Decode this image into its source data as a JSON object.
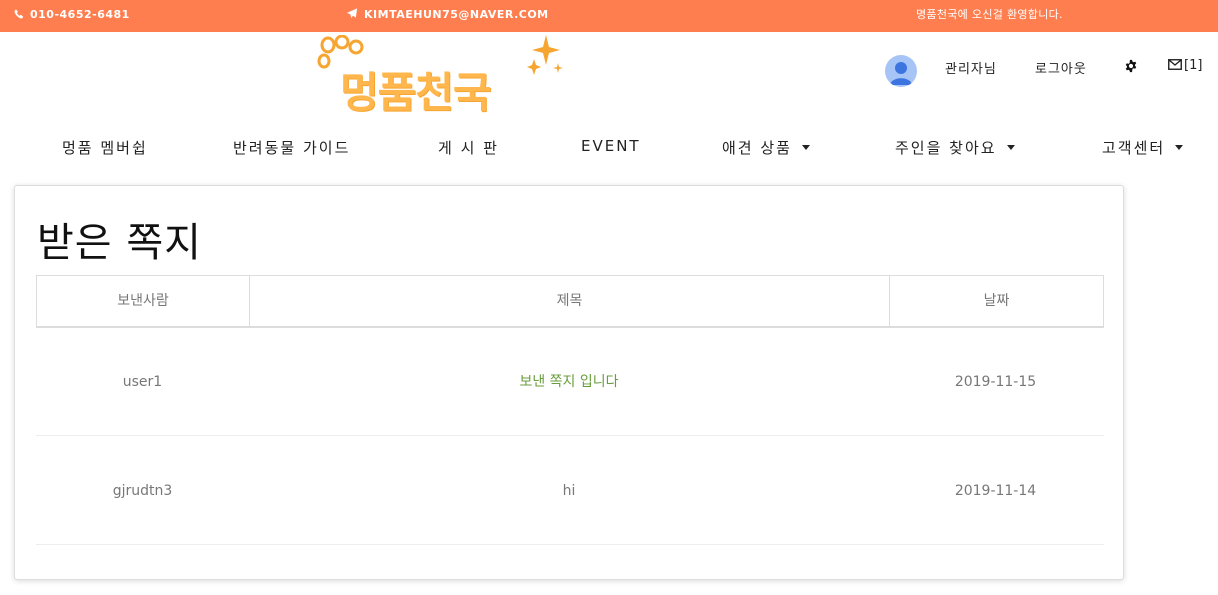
{
  "topbar": {
    "phone": "010-4652-6481",
    "email": "KIMTAEHUN75@NAVER.COM",
    "welcome": "명품천국에 오신걸 환영합니다."
  },
  "brand": {
    "logo_text": "멍품천국"
  },
  "header": {
    "admin_label": "관리자님",
    "logout_label": "로그아웃",
    "message_count": "[1]"
  },
  "nav": {
    "items": [
      {
        "label": "멍품 멤버쉽",
        "dropdown": false
      },
      {
        "label": "반려동물 가이드",
        "dropdown": false
      },
      {
        "label": "게 시 판",
        "dropdown": false
      },
      {
        "label": "EVENT",
        "dropdown": false
      },
      {
        "label": "애견 상품",
        "dropdown": true
      },
      {
        "label": "주인을 찾아요",
        "dropdown": true
      },
      {
        "label": "고객센터",
        "dropdown": true
      }
    ]
  },
  "inbox": {
    "title": "받은 쪽지",
    "columns": [
      "보낸사람",
      "제목",
      "날짜"
    ],
    "rows": [
      {
        "sender": "user1",
        "subject": "보낸 쪽지 입니다",
        "date": "2019-11-15"
      },
      {
        "sender": "gjrudtn3",
        "subject": "hi",
        "date": "2019-11-14"
      }
    ]
  },
  "colors": {
    "topbar": "#ff7e4f",
    "logo": "#ffb74d",
    "link_green": "#6a9e3c",
    "avatar": "#a6c4f5"
  },
  "icons": [
    "phone-icon",
    "paper-plane-icon",
    "paw-icon",
    "sparkle-icon",
    "avatar-icon",
    "gear-icon",
    "envelope-icon",
    "caret-down-icon"
  ]
}
